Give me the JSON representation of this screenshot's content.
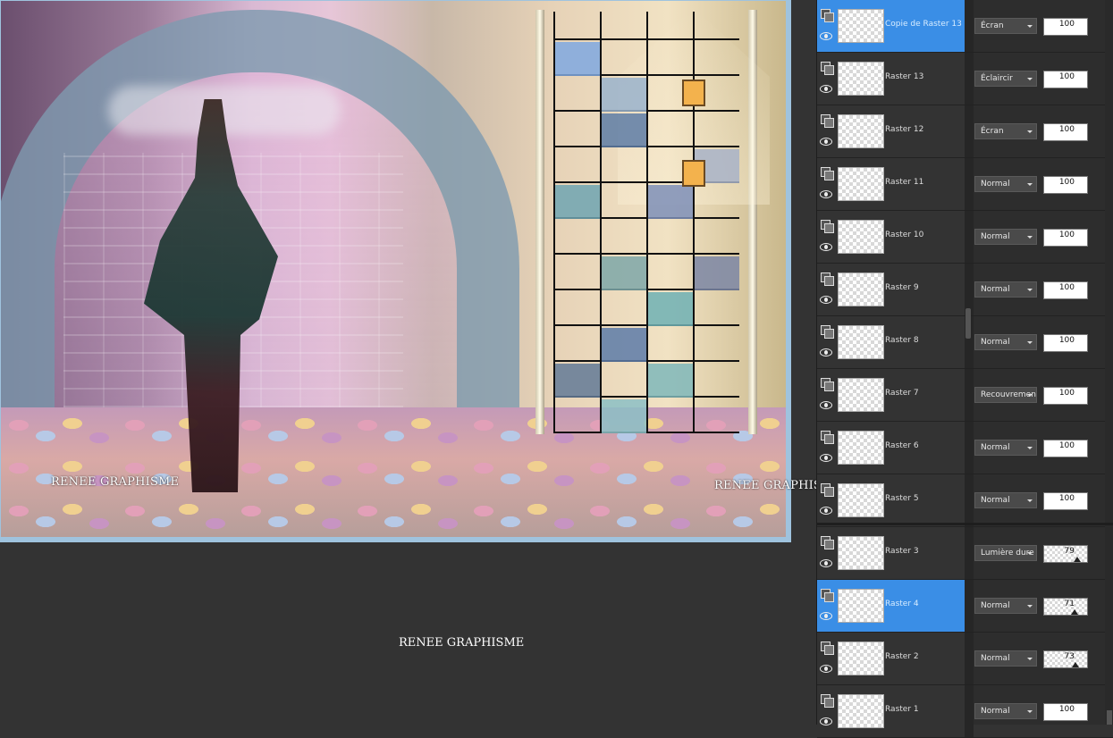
{
  "canvas": {
    "watermark_left": "RENEE GRAPHISME",
    "watermark_right": "RENEE GRAPHISME"
  },
  "workspace": {
    "watermark": "RENEE GRAPHISME"
  },
  "layers": [
    {
      "name": "Copie de Raster 13",
      "blend": "Écran",
      "opacity": "100",
      "selected": true
    },
    {
      "name": "Raster 13",
      "blend": "Éclaircir",
      "opacity": "100",
      "selected": false
    },
    {
      "name": "Raster 12",
      "blend": "Écran",
      "opacity": "100",
      "selected": false
    },
    {
      "name": "Raster 11",
      "blend": "Normal",
      "opacity": "100",
      "selected": false
    },
    {
      "name": "Raster 10",
      "blend": "Normal",
      "opacity": "100",
      "selected": false
    },
    {
      "name": "Raster 9",
      "blend": "Normal",
      "opacity": "100",
      "selected": false
    },
    {
      "name": "Raster 8",
      "blend": "Normal",
      "opacity": "100",
      "selected": false
    },
    {
      "name": "Raster 7",
      "blend": "Recouvrement",
      "opacity": "100",
      "selected": false
    },
    {
      "name": "Raster 6",
      "blend": "Normal",
      "opacity": "100",
      "selected": false
    },
    {
      "name": "Raster 5",
      "blend": "Normal",
      "opacity": "100",
      "selected": false
    },
    {
      "name": "Raster 3",
      "blend": "Lumière dure",
      "opacity": "79",
      "selected": false
    },
    {
      "name": "Raster 4",
      "blend": "Normal",
      "opacity": "71",
      "selected": true
    },
    {
      "name": "Raster 2",
      "blend": "Normal",
      "opacity": "73",
      "selected": false
    },
    {
      "name": "Raster 1",
      "blend": "Normal",
      "opacity": "100",
      "selected": false
    }
  ],
  "colors": {
    "selection": "#3a8ee6",
    "panel": "#2d2d2d",
    "workspace": "#333333",
    "canvas_border": "#9fc3de"
  }
}
